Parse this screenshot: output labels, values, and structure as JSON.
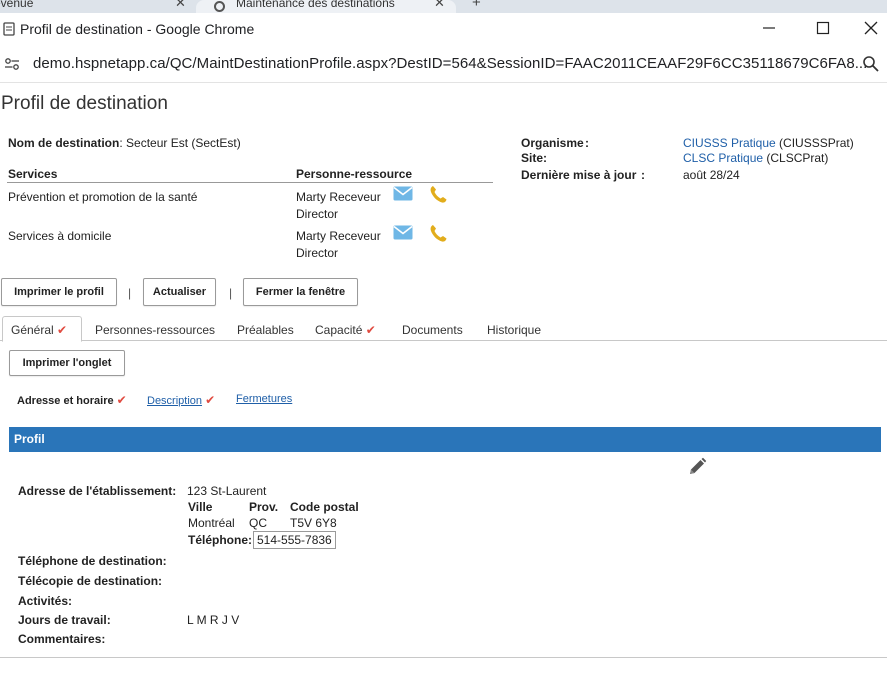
{
  "browser": {
    "background_tab_title": "evenue",
    "active_tab_title": "Maintenance des destinations",
    "window_title": "Profil de destination - Google Chrome",
    "url": "demo.hspnetapp.ca/QC/MaintDestinationProfile.aspx?DestID=564&SessionID=FAAC2011CEAAF29F6CC35118679C6FA8..."
  },
  "page": {
    "title": "Profil de destination",
    "destination": {
      "label": "Nom de destination",
      "value": ": Secteur Est (SectEst)"
    },
    "org": {
      "organisme_label": "Organisme",
      "organisme_colon": ":",
      "organisme_link": "CIUSSS Pratique",
      "organisme_code": " (CIUSSSPrat)",
      "site_label": "Site",
      "site_colon": ":",
      "site_link": "CLSC Pratique",
      "site_code": " (CLSCPrat)",
      "maj_label": "Dernière mise à jour",
      "maj_colon": ":",
      "maj_value": "août 28/24"
    },
    "services": {
      "col_services": "Services",
      "col_contact": "Personne-ressource",
      "rows": [
        {
          "service": "Prévention et promotion de la santé",
          "contact": "Marty Receveur",
          "role": "Director"
        },
        {
          "service": "Services à domicile",
          "contact": "Marty Receveur",
          "role": "Director"
        }
      ]
    },
    "buttons": {
      "print_profile": "Imprimer le profil",
      "refresh": "Actualiser",
      "close_window": "Fermer la fenêtre",
      "separator": "|"
    },
    "tabs": [
      {
        "label": "Général",
        "check": "✔"
      },
      {
        "label": "Personnes-ressources"
      },
      {
        "label": "Préalables"
      },
      {
        "label": "Capacité",
        "check": "✔"
      },
      {
        "label": "Documents"
      },
      {
        "label": "Historique"
      }
    ],
    "print_tab_button": "Imprimer l'onglet",
    "subnav": {
      "address_hours": "Adresse et horaire",
      "description": "Description",
      "closures": "Fermetures",
      "check": "✔"
    },
    "profil": {
      "section_title": "Profil",
      "address_label": "Adresse de l'établissement:",
      "address_value": "123 St-Laurent",
      "city_header": "Ville",
      "prov_header": "Prov.",
      "postal_header": "Code postal",
      "city_value": "Montréal",
      "prov_value": "QC",
      "postal_value": "T5V 6Y8",
      "phone_label": "Téléphone:",
      "phone_value": "514-555-7836",
      "dest_phone_label": "Téléphone de destination:",
      "dest_fax_label": "Télécopie de destination:",
      "activities_label": "Activités:",
      "workdays_label": "Jours de travail:",
      "workdays_value": "L M R J V",
      "comments_label": "Commentaires:"
    }
  },
  "colors": {
    "accent_blue": "#2a75b9",
    "link_blue": "#1f5fa8",
    "check_red": "#e04a3f",
    "mail_blue": "#6fb7e6",
    "phone_gold": "#e2ad1c"
  }
}
